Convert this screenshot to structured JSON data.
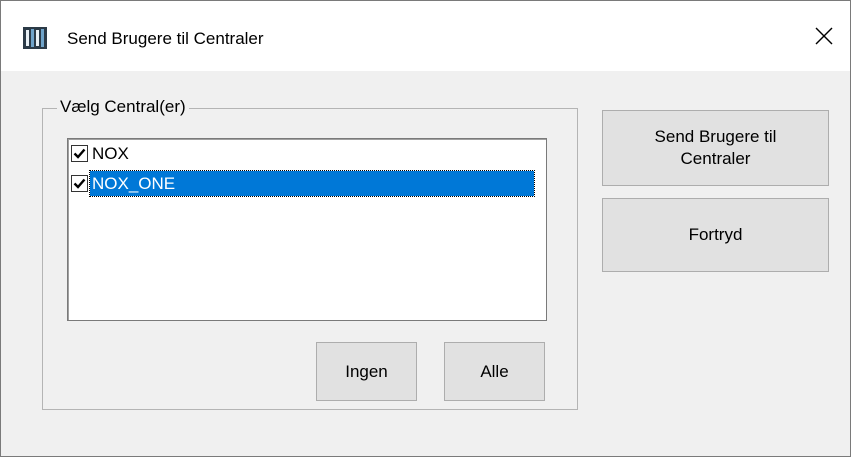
{
  "window": {
    "title": "Send Brugere til Centraler",
    "app_icon": "app-icon",
    "close_icon": "close-icon"
  },
  "group": {
    "legend": "Vælg Central(er)",
    "items": [
      {
        "label": "NOX",
        "checked": true,
        "selected": false
      },
      {
        "label": "NOX_ONE",
        "checked": true,
        "selected": true
      }
    ],
    "none_button": "Ingen",
    "all_button": "Alle"
  },
  "actions": {
    "send_button": "Send Brugere til Centraler",
    "cancel_button": "Fortryd"
  },
  "colors": {
    "selection": "#0078d7",
    "dialog_bg": "#f0f0f0",
    "button_bg": "#e1e1e1"
  }
}
